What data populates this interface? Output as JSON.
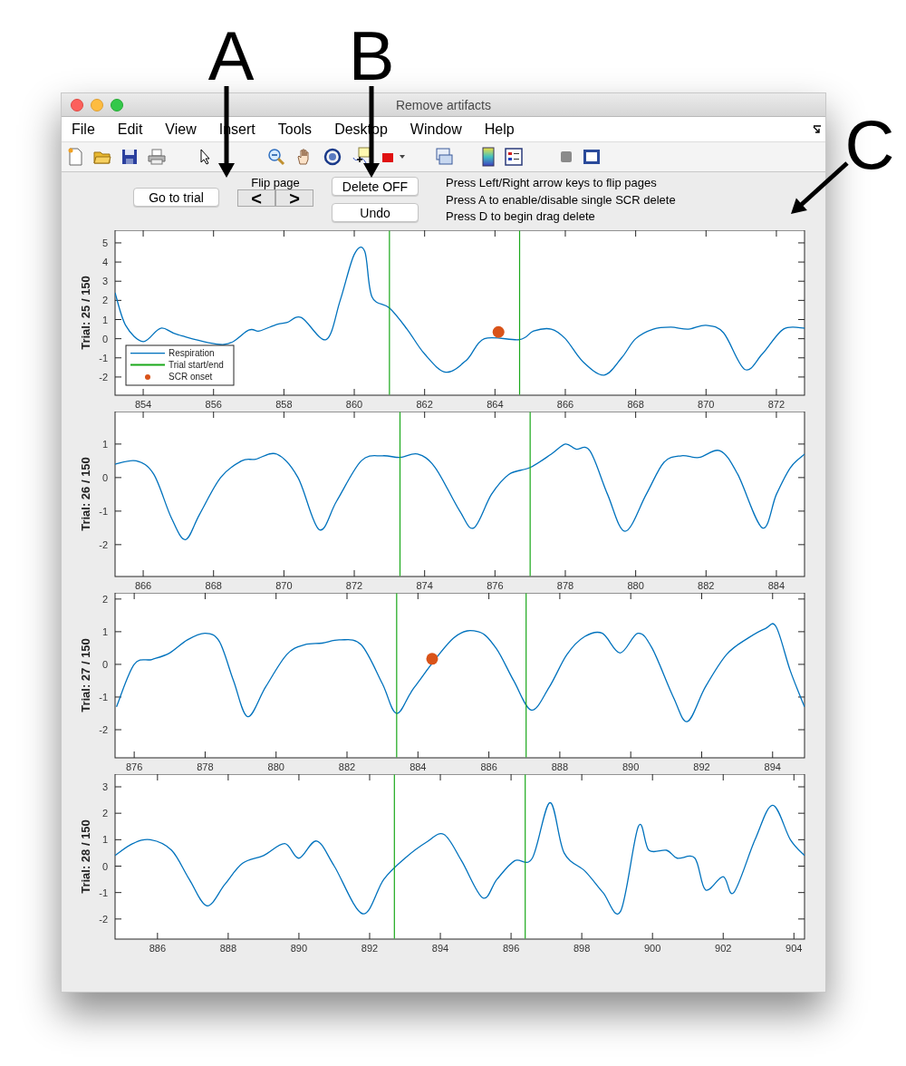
{
  "window": {
    "title": "Remove artifacts"
  },
  "menu": [
    "File",
    "Edit",
    "View",
    "Insert",
    "Tools",
    "Desktop",
    "Window",
    "Help"
  ],
  "controls": {
    "go_to_trial": "Go to trial",
    "flip_page_label": "Flip page",
    "prev": "<",
    "next": ">",
    "delete_toggle": "Delete OFF",
    "undo": "Undo"
  },
  "instructions": [
    "Press Left/Right arrow keys to flip pages",
    "Press A to enable/disable single SCR delete",
    "Press D to begin drag delete"
  ],
  "figure_labels": [
    "A",
    "B",
    "C"
  ],
  "plots": [
    {
      "legend_entries": [
        {
          "label": "Trial start/end",
          "color": "#1aa81a"
        }
      ],
      "chart_data": {
        "type": "line",
        "ylabel": "Trial:  25 / 150",
        "legend": true,
        "xlim": [
          853.2,
          872.8
        ],
        "ylim": [
          -2.95,
          5.66
        ],
        "xticks": [
          854,
          856,
          858,
          860,
          862,
          864,
          866,
          868,
          870,
          872
        ],
        "yticks": [
          -2,
          -1,
          0,
          1,
          2,
          3,
          4,
          5
        ],
        "x": [
          853.2,
          853.5,
          854.0,
          854.5,
          855.0,
          855.5,
          856.0,
          856.3,
          857.0,
          857.3,
          857.8,
          858.1,
          858.5,
          859.2,
          859.6,
          860.0,
          860.3,
          860.5,
          861.0,
          861.5,
          862.0,
          862.6,
          863.2,
          863.7,
          864.1,
          864.7,
          865.1,
          865.6,
          866.0,
          866.5,
          867.1,
          867.6,
          868.0,
          868.5,
          869.0,
          869.5,
          870.0,
          870.5,
          871.1,
          871.6,
          872.2,
          872.8
        ],
        "series": [
          {
            "name": "Respiration",
            "color": "#0072bd",
            "values": [
              2.4,
              0.7,
              -0.15,
              0.55,
              0.2,
              null,
              null,
              -0.3,
              0.45,
              0.4,
              0.75,
              0.85,
              1.1,
              -0.05,
              2.0,
              4.4,
              4.55,
              2.2,
              1.6,
              0.5,
              -0.8,
              -1.75,
              -1.1,
              0.0,
              null,
              -0.05,
              0.4,
              0.5,
              0.0,
              -1.2,
              -1.9,
              -1.0,
              0.0,
              0.5,
              0.6,
              0.5,
              0.7,
              0.3,
              -1.6,
              -0.8,
              0.5,
              0.55
            ]
          },
          {
            "name": "SCR onset",
            "type": "scatter",
            "color": "#d95319",
            "values": [
              null,
              null,
              null,
              null,
              null,
              null,
              null,
              null,
              null,
              null,
              null,
              null,
              null,
              null,
              null,
              null,
              null,
              null,
              null,
              null,
              null,
              null,
              null,
              null,
              0.35,
              null,
              null,
              null,
              null,
              null,
              null,
              null,
              null,
              null,
              null,
              null,
              null,
              null,
              null,
              null,
              null,
              null
            ]
          }
        ],
        "ref_lines": [
          {
            "axis": "x",
            "value": 861.0,
            "color": "#1aa81a"
          },
          {
            "axis": "x",
            "value": 864.7,
            "color": "#1aa81a"
          }
        ]
      }
    },
    {
      "chart_data": {
        "type": "line",
        "ylabel": "Trial:  26 / 150",
        "xlim": [
          865.2,
          884.8
        ],
        "ylim": [
          -2.95,
          1.97
        ],
        "xticks": [
          866,
          868,
          870,
          872,
          874,
          876,
          878,
          880,
          882,
          884
        ],
        "yticks": [
          -2,
          -1,
          0,
          1
        ],
        "x": [
          865.2,
          865.8,
          866.3,
          866.8,
          867.2,
          867.6,
          868.2,
          868.8,
          869.2,
          869.8,
          870.4,
          871.0,
          871.5,
          872.2,
          872.8,
          873.3,
          873.8,
          874.3,
          875.0,
          875.4,
          875.9,
          876.4,
          877.0,
          877.6,
          878.0,
          878.3,
          878.7,
          879.2,
          879.7,
          880.3,
          880.8,
          881.3,
          881.8,
          882.4,
          882.9,
          883.6,
          884.0,
          884.4,
          884.8
        ],
        "series": [
          {
            "color": "#0072bd",
            "values": [
              0.4,
              0.5,
              0.1,
              -1.2,
              -1.85,
              -1.1,
              0.0,
              0.5,
              0.55,
              0.7,
              0.0,
              -1.55,
              -0.7,
              0.5,
              0.65,
              0.6,
              0.7,
              0.3,
              -1.0,
              -1.5,
              -0.5,
              0.1,
              0.3,
              0.7,
              1.0,
              0.85,
              0.8,
              -0.5,
              -1.6,
              -0.5,
              0.45,
              0.65,
              0.6,
              0.8,
              0.1,
              -1.5,
              -0.5,
              0.3,
              0.7
            ]
          }
        ],
        "ref_lines": [
          {
            "axis": "x",
            "value": 873.3,
            "color": "#1aa81a"
          },
          {
            "axis": "x",
            "value": 877.0,
            "color": "#1aa81a"
          }
        ]
      }
    },
    {
      "chart_data": {
        "type": "line",
        "ylabel": "Trial:  27 / 150",
        "xlim": [
          875.46,
          894.9
        ],
        "ylim": [
          -2.86,
          2.19
        ],
        "xticks": [
          876,
          878,
          880,
          882,
          884,
          886,
          888,
          890,
          892,
          894
        ],
        "yticks": [
          -2,
          -1,
          0,
          1,
          2
        ],
        "x": [
          875.5,
          876.0,
          876.5,
          877.0,
          877.5,
          878.0,
          878.4,
          878.8,
          879.2,
          879.7,
          880.3,
          880.8,
          881.3,
          881.8,
          882.4,
          883.0,
          883.4,
          883.9,
          884.4,
          885.0,
          885.7,
          886.2,
          886.7,
          887.2,
          887.7,
          888.2,
          888.7,
          889.2,
          889.7,
          890.2,
          890.6,
          891.2,
          891.6,
          892.1,
          892.7,
          893.3,
          893.8,
          894.1,
          894.5,
          894.9
        ],
        "series": [
          {
            "color": "#0072bd",
            "values": [
              -1.3,
              0.0,
              0.15,
              0.35,
              0.75,
              0.95,
              0.7,
              -0.5,
              -1.6,
              -0.7,
              0.3,
              0.6,
              0.65,
              0.75,
              0.6,
              -0.6,
              -1.5,
              -0.7,
              null,
              0.8,
              1.0,
              0.5,
              -0.5,
              -1.4,
              -0.7,
              0.3,
              0.85,
              0.95,
              0.35,
              0.95,
              0.5,
              -1.0,
              -1.75,
              -0.7,
              0.3,
              0.8,
              1.1,
              1.15,
              -0.2,
              -1.3
            ]
          },
          {
            "type": "scatter",
            "color": "#d95319",
            "values": [
              null,
              null,
              null,
              null,
              null,
              null,
              null,
              null,
              null,
              null,
              null,
              null,
              null,
              null,
              null,
              null,
              null,
              null,
              0.17,
              null,
              null,
              null,
              null,
              null,
              null,
              null,
              null,
              null,
              null,
              null,
              null,
              null,
              null,
              null,
              null,
              null,
              null,
              null,
              null,
              null
            ]
          }
        ],
        "ref_lines": [
          {
            "axis": "x",
            "value": 883.4,
            "color": "#1aa81a"
          },
          {
            "axis": "x",
            "value": 887.05,
            "color": "#1aa81a"
          }
        ]
      }
    },
    {
      "chart_data": {
        "type": "line",
        "ylabel": "Trial:  28 / 150",
        "xlim": [
          884.8,
          904.3
        ],
        "ylim": [
          -2.76,
          3.48
        ],
        "xticks": [
          886,
          888,
          890,
          892,
          894,
          896,
          898,
          900,
          902,
          904
        ],
        "yticks": [
          -2,
          -1,
          0,
          1,
          2,
          3
        ],
        "x": [
          884.8,
          885.3,
          885.8,
          886.4,
          886.9,
          887.4,
          887.9,
          888.4,
          889.0,
          889.6,
          890.0,
          890.5,
          891.0,
          891.8,
          892.4,
          893.0,
          893.6,
          894.1,
          894.6,
          895.2,
          895.6,
          896.1,
          896.6,
          897.1,
          897.5,
          898.1,
          898.6,
          899.1,
          899.6,
          899.9,
          900.4,
          900.7,
          901.2,
          901.5,
          902.0,
          902.3,
          902.9,
          903.4,
          903.9,
          904.3
        ],
        "series": [
          {
            "color": "#0072bd",
            "values": [
              0.4,
              0.85,
              1.0,
              0.6,
              -0.5,
              -1.5,
              -0.7,
              0.1,
              0.4,
              0.85,
              0.3,
              0.95,
              0.0,
              -1.8,
              -0.5,
              0.3,
              0.9,
              1.2,
              0.2,
              -1.2,
              -0.5,
              0.2,
              0.3,
              2.4,
              0.5,
              -0.2,
              -1.0,
              -1.7,
              1.5,
              0.6,
              0.6,
              0.3,
              0.3,
              -0.9,
              -0.4,
              -1.0,
              1.0,
              2.3,
              1.0,
              0.4
            ]
          }
        ],
        "ref_lines": [
          {
            "axis": "x",
            "value": 892.7,
            "color": "#1aa81a"
          },
          {
            "axis": "x",
            "value": 896.4,
            "color": "#1aa81a"
          }
        ]
      }
    }
  ]
}
